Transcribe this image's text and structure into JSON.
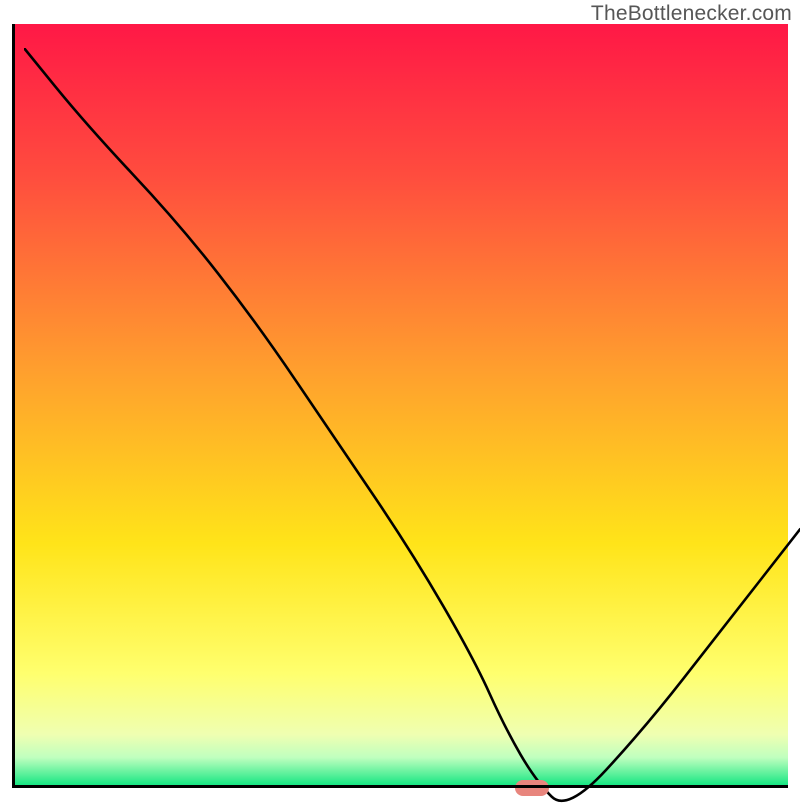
{
  "attribution": "TheBottlenecker.com",
  "chart_data": {
    "type": "line",
    "title": "",
    "xlabel": "",
    "ylabel": "",
    "xlim": [
      0,
      100
    ],
    "ylim": [
      0,
      100
    ],
    "x": [
      0,
      8,
      20,
      30,
      40,
      50,
      58,
      62,
      66,
      70,
      80,
      90,
      100
    ],
    "values": [
      100,
      90,
      77,
      64,
      49,
      34,
      20,
      11,
      4,
      0,
      11,
      24,
      37
    ],
    "marker": {
      "x": 67,
      "y": 0
    },
    "gradient_stops": [
      {
        "pct": 0,
        "color": "#ff1846"
      },
      {
        "pct": 20,
        "color": "#ff4d3e"
      },
      {
        "pct": 45,
        "color": "#ff9e2e"
      },
      {
        "pct": 68,
        "color": "#ffe419"
      },
      {
        "pct": 85,
        "color": "#ffff6e"
      },
      {
        "pct": 93,
        "color": "#efffb1"
      },
      {
        "pct": 96,
        "color": "#c0ffbf"
      },
      {
        "pct": 100,
        "color": "#05e47c"
      }
    ]
  }
}
